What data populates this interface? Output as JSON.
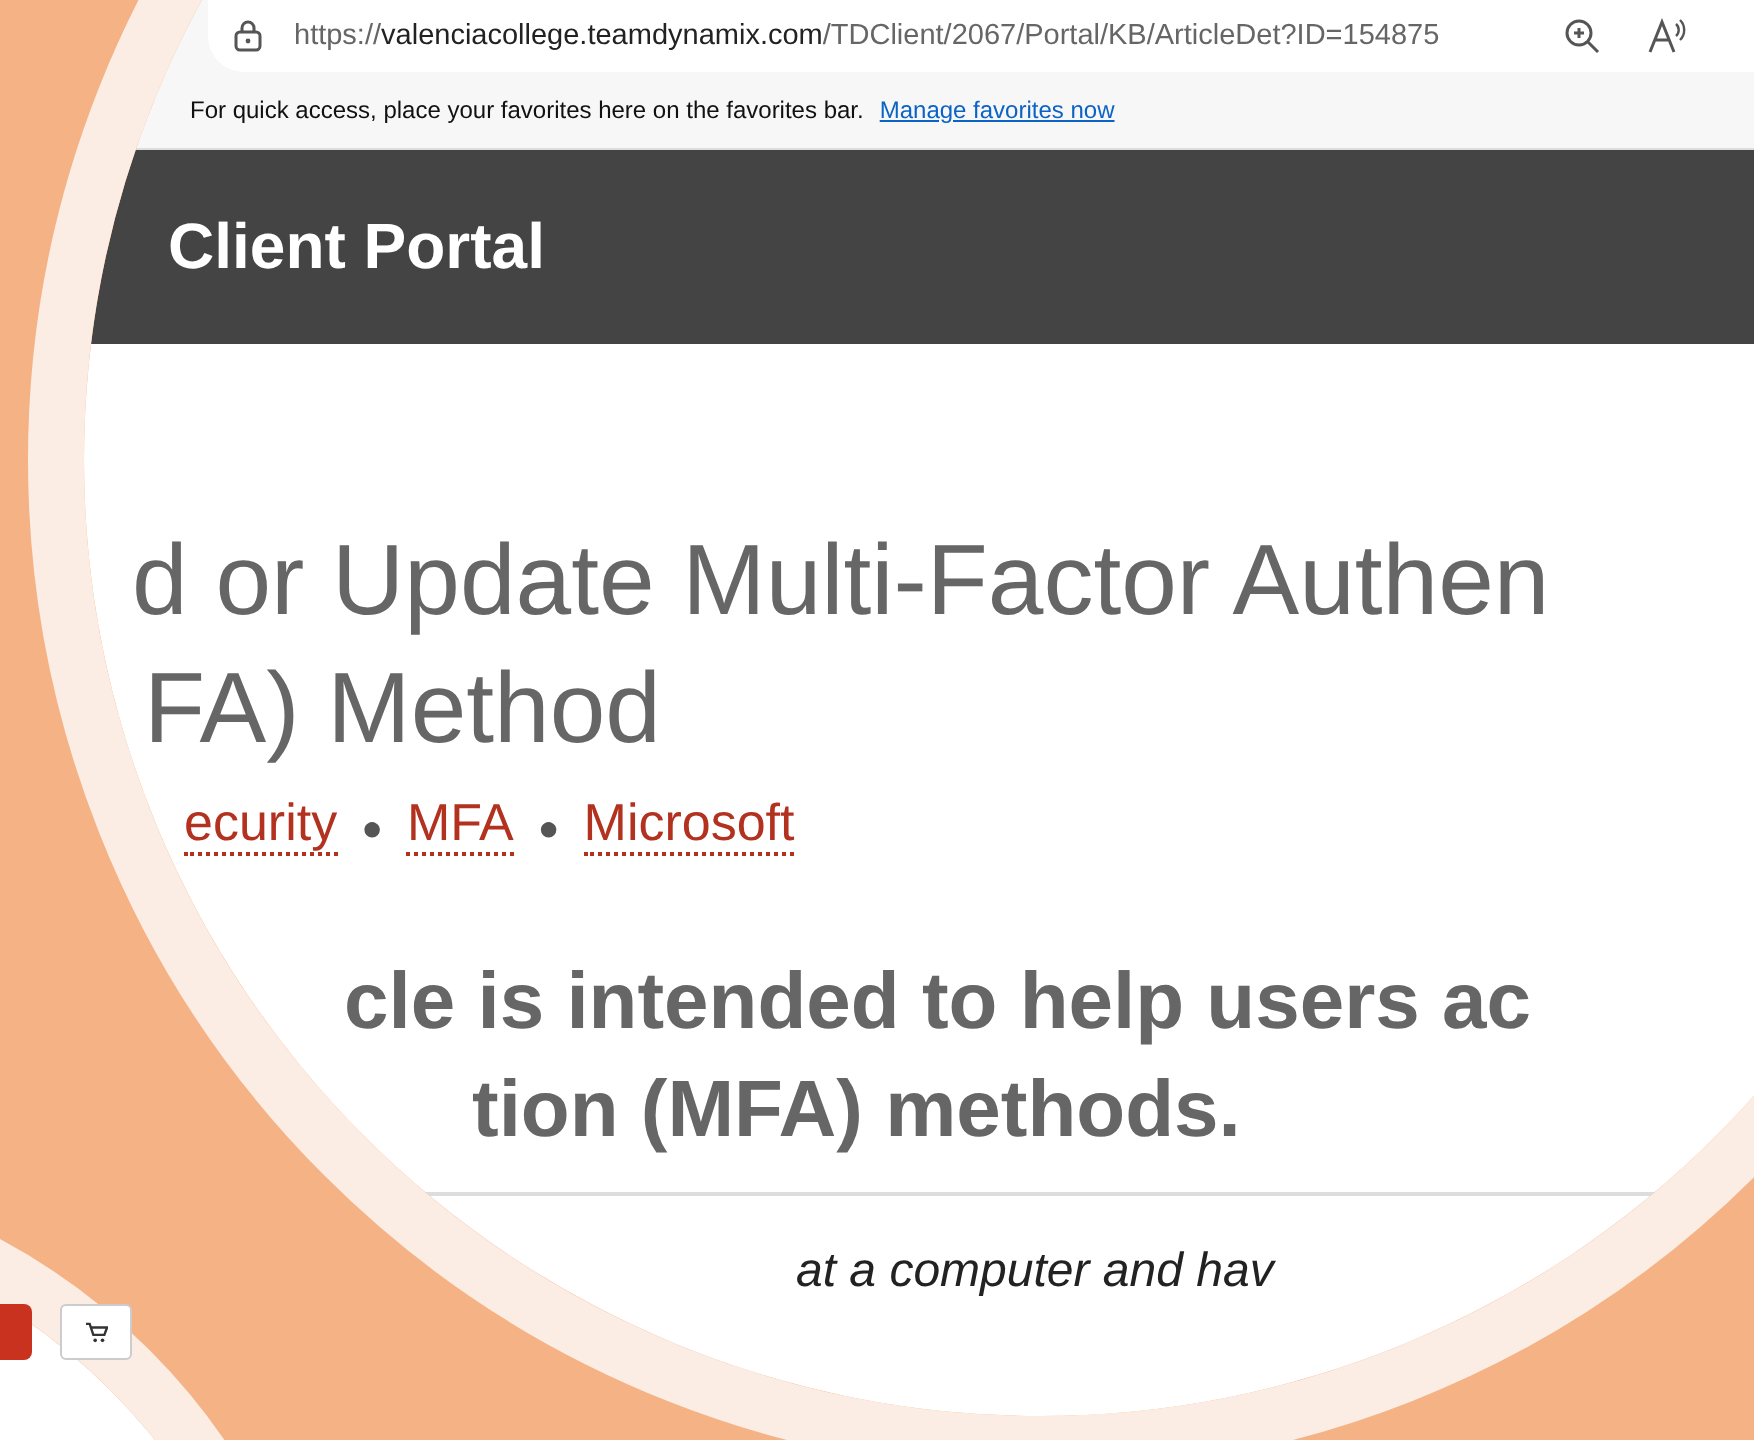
{
  "browser": {
    "url_scheme": "https://",
    "url_host": "valenciacollege.teamdynamix.com",
    "url_path": "/TDClient/2067/Portal/KB/ArticleDet?ID=154875"
  },
  "favorites_bar": {
    "message": "For quick access, place your favorites here on the favorites bar.",
    "link": "Manage favorites now"
  },
  "header": {
    "title": "Client Portal"
  },
  "article": {
    "title_lines": [
      "d or Update Multi-Factor Authen",
      "FA) Method"
    ],
    "tags": [
      {
        "label": "ecurity",
        "separator": "●"
      },
      {
        "label": "MFA",
        "separator": "●"
      },
      {
        "label": "Microsoft"
      }
    ],
    "summary_lines": [
      "cle is intended to help users ac",
      "tion (MFA) methods."
    ],
    "body_fragment": "at a computer and hav"
  }
}
